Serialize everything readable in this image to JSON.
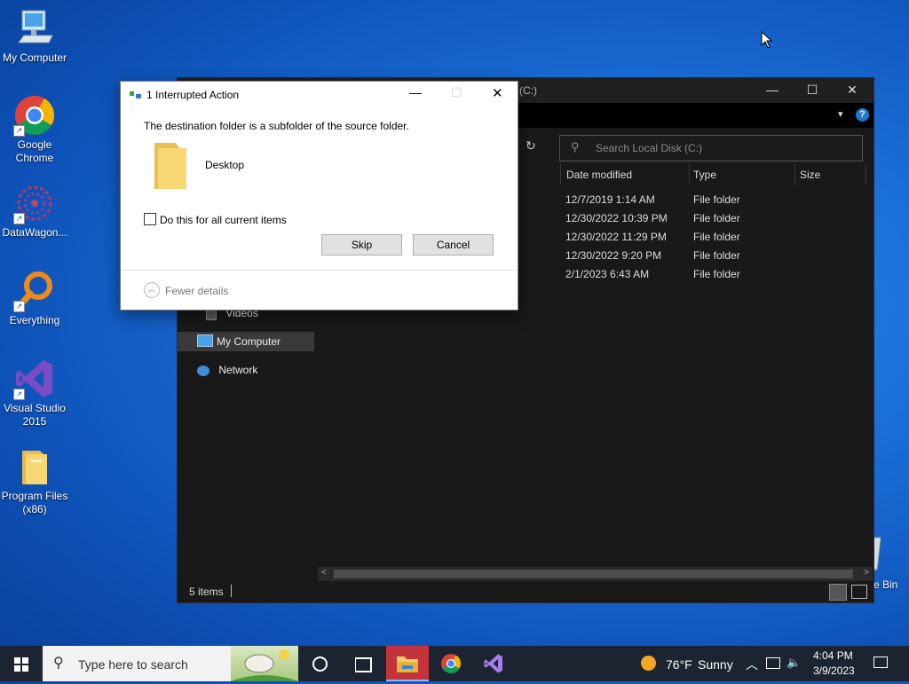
{
  "desktop": {
    "icons": [
      {
        "label": "My Computer"
      },
      {
        "label": "Google Chrome"
      },
      {
        "label": "DataWagon..."
      },
      {
        "label": "Everything"
      },
      {
        "label": "Visual Studio 2015"
      },
      {
        "label": "Program Files (x86)"
      },
      {
        "label": "e Bin"
      }
    ]
  },
  "explorer": {
    "title": "(C:)",
    "search_placeholder": "Search Local Disk (C:)",
    "columns": [
      "Date modified",
      "Type",
      "Size"
    ],
    "rows": [
      {
        "date": "12/7/2019 1:14 AM",
        "type": "File folder"
      },
      {
        "date": "12/30/2022 10:39 PM",
        "type": "File folder"
      },
      {
        "date": "12/30/2022 11:29 PM",
        "type": "File folder"
      },
      {
        "date": "12/30/2022 9:20 PM",
        "type": "File folder"
      },
      {
        "date": "2/1/2023 6:43 AM",
        "type": "File folder"
      }
    ],
    "nav": [
      {
        "label": "Videos"
      },
      {
        "label": "My Computer"
      },
      {
        "label": "Network"
      }
    ],
    "status": "5 items"
  },
  "dialog": {
    "title": "1 Interrupted Action",
    "message": "The destination folder is a subfolder of the source folder.",
    "folder_name": "Desktop",
    "checkbox_label": "Do this for all current items",
    "skip_label": "Skip",
    "cancel_label": "Cancel",
    "fewer_details": "Fewer details"
  },
  "taskbar": {
    "search_placeholder": "Type here to search",
    "weather_temp": "76°F",
    "weather_text": "Sunny",
    "time": "4:04 PM",
    "date": "3/9/2023"
  },
  "colors": {
    "desktop": "#1a6fd8",
    "explorer_bg": "#191919",
    "taskbar": "#1b2430",
    "accent_red": "#c4323a",
    "folder_yellow": "#f4cf63"
  }
}
